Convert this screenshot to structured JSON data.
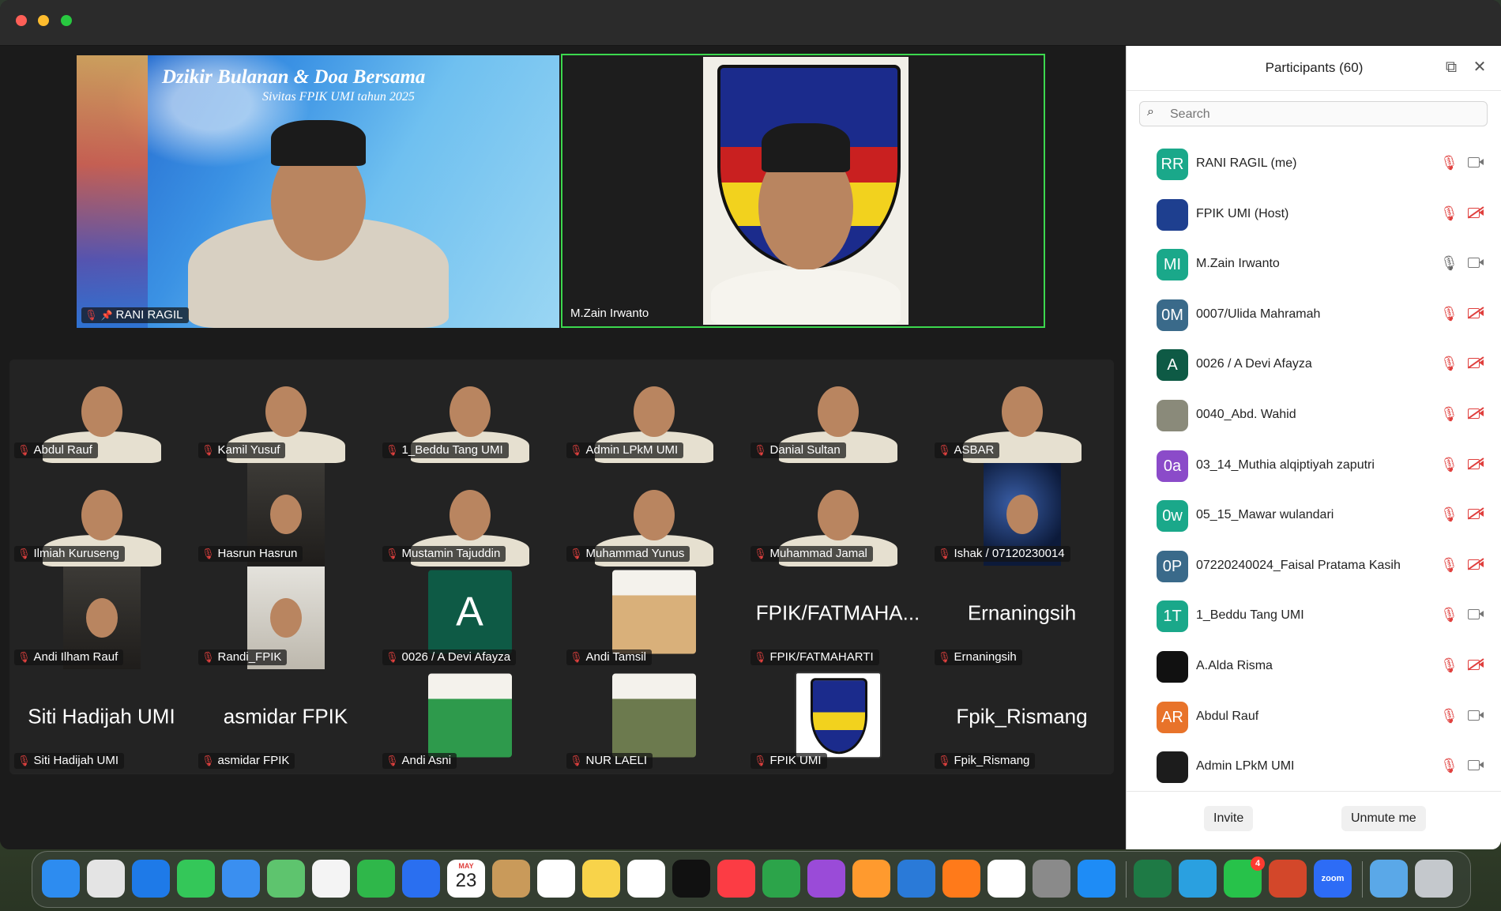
{
  "app": {
    "window": "Zoom Meeting"
  },
  "banner": {
    "title": "Dzikir Bulanan & Doa Bersama",
    "subtitle": "Sivitas FPIK UMI tahun 2025"
  },
  "speakers": [
    {
      "name": "RANI RAGIL",
      "pinned": true
    },
    {
      "name": "M.Zain Irwanto",
      "active": true
    }
  ],
  "grid": [
    {
      "name": "Abdul Rauf",
      "kind": "video",
      "bg": "banner"
    },
    {
      "name": "Kamil Yusuf",
      "kind": "video",
      "bg": "banner"
    },
    {
      "name": "1_Beddu Tang UMI",
      "kind": "video",
      "bg": "banner"
    },
    {
      "name": "Admin LPkM UMI",
      "kind": "video",
      "bg": "room"
    },
    {
      "name": "Danial Sultan",
      "kind": "video",
      "bg": "light"
    },
    {
      "name": "ASBAR",
      "kind": "video",
      "bg": "dark"
    },
    {
      "name": "Ilmiah Kuruseng",
      "kind": "video",
      "bg": "mosque"
    },
    {
      "name": "Hasrun Hasrun",
      "kind": "smallvideo",
      "bg": "dark"
    },
    {
      "name": "Mustamin Tajuddin",
      "kind": "video",
      "bg": "yellow"
    },
    {
      "name": "Muhammad Yunus",
      "kind": "video",
      "bg": "space"
    },
    {
      "name": "Muhammad Jamal",
      "kind": "video",
      "bg": "light"
    },
    {
      "name": "Ishak / 07120230014",
      "kind": "smallvideo",
      "bg": "space"
    },
    {
      "name": "Andi Ilham Rauf",
      "kind": "smallvideo",
      "bg": "dark"
    },
    {
      "name": "Randi_FPIK",
      "kind": "smallvideo",
      "bg": "light"
    },
    {
      "name": "0026 / A Devi Afayza",
      "kind": "avatar",
      "initial": "A",
      "color": "#0e5a45"
    },
    {
      "name": "Andi Tamsil",
      "kind": "photo",
      "color": "#d9b07a"
    },
    {
      "name": "FPIK/FATMAHARTI",
      "kind": "text",
      "display": "FPIK/FATMAHA..."
    },
    {
      "name": "Ernaningsih",
      "kind": "text",
      "display": "Ernaningsih"
    },
    {
      "name": "Siti Hadijah UMI",
      "kind": "text",
      "display": "Siti Hadijah UMI"
    },
    {
      "name": "asmidar FPIK",
      "kind": "text",
      "display": "asmidar FPIK"
    },
    {
      "name": "Andi Asni",
      "kind": "photo",
      "color": "#2e9a4c"
    },
    {
      "name": "NUR LAELI",
      "kind": "photo",
      "color": "#6c7a4e"
    },
    {
      "name": "FPIK UMI",
      "kind": "logo"
    },
    {
      "name": "Fpik_Rismang",
      "kind": "text",
      "display": "Fpik_Rismang"
    }
  ],
  "panel": {
    "title": "Participants (60)",
    "search_placeholder": "Search",
    "participants": [
      {
        "name": "RANI RAGIL (me)",
        "initials": "RR",
        "color": "#1aa88a",
        "mic": "muted",
        "cam": "on"
      },
      {
        "name": "FPIK UMI (Host)",
        "initials": "",
        "color": "#1e3f8f",
        "mic": "muted",
        "cam": "off"
      },
      {
        "name": "M.Zain Irwanto",
        "initials": "MI",
        "color": "#1aa88a",
        "mic": "on",
        "cam": "on"
      },
      {
        "name": "0007/Ulida Mahramah",
        "initials": "0M",
        "color": "#3a6a8a",
        "mic": "muted",
        "cam": "off"
      },
      {
        "name": "0026 / A Devi Afayza",
        "initials": "A",
        "color": "#0e5a45",
        "mic": "muted",
        "cam": "off"
      },
      {
        "name": "0040_Abd. Wahid",
        "initials": "",
        "color": "#8a8a7a",
        "mic": "muted",
        "cam": "off"
      },
      {
        "name": "03_14_Muthia alqiptiyah zaputri",
        "initials": "0a",
        "color": "#8b4bc9",
        "mic": "muted",
        "cam": "off"
      },
      {
        "name": "05_15_Mawar wulandari",
        "initials": "0w",
        "color": "#1aa88a",
        "mic": "muted",
        "cam": "off"
      },
      {
        "name": "07220240024_Faisal Pratama Kasih",
        "initials": "0P",
        "color": "#3a6a8a",
        "mic": "muted",
        "cam": "off"
      },
      {
        "name": "1_Beddu Tang UMI",
        "initials": "1T",
        "color": "#1aa88a",
        "mic": "muted",
        "cam": "on"
      },
      {
        "name": "A.Alda Risma",
        "initials": "",
        "color": "#111111",
        "mic": "muted",
        "cam": "off"
      },
      {
        "name": "Abdul Rauf",
        "initials": "AR",
        "color": "#e8732a",
        "mic": "muted",
        "cam": "on"
      },
      {
        "name": "Admin LPkM UMI",
        "initials": "",
        "color": "#1c1c1c",
        "mic": "muted",
        "cam": "on"
      }
    ],
    "invite_label": "Invite",
    "unmute_label": "Unmute me"
  },
  "dock": {
    "calendar_month": "MAY",
    "calendar_day": "23",
    "whatsapp_badge": "4",
    "zoom_label": "zoom",
    "apps": [
      "finder-icon",
      "launchpad-icon",
      "safari-icon",
      "messages-icon",
      "mail-icon",
      "maps-icon",
      "photos-icon",
      "facetime-icon",
      "keynote-icon",
      "calendar-icon",
      "contacts-icon",
      "reminders-icon",
      "notes-icon",
      "freeform-icon",
      "appletv-icon",
      "music-icon",
      "numbers-icon",
      "podcasts-icon",
      "pages-icon",
      "edge-icon",
      "firefox-icon",
      "chrome-icon",
      "settings-icon",
      "appstore-icon",
      "excel-icon",
      "telegram-icon",
      "whatsapp-icon",
      "powerpoint-icon",
      "zoom-icon",
      "downloads-folder-icon",
      "trash-icon"
    ]
  }
}
